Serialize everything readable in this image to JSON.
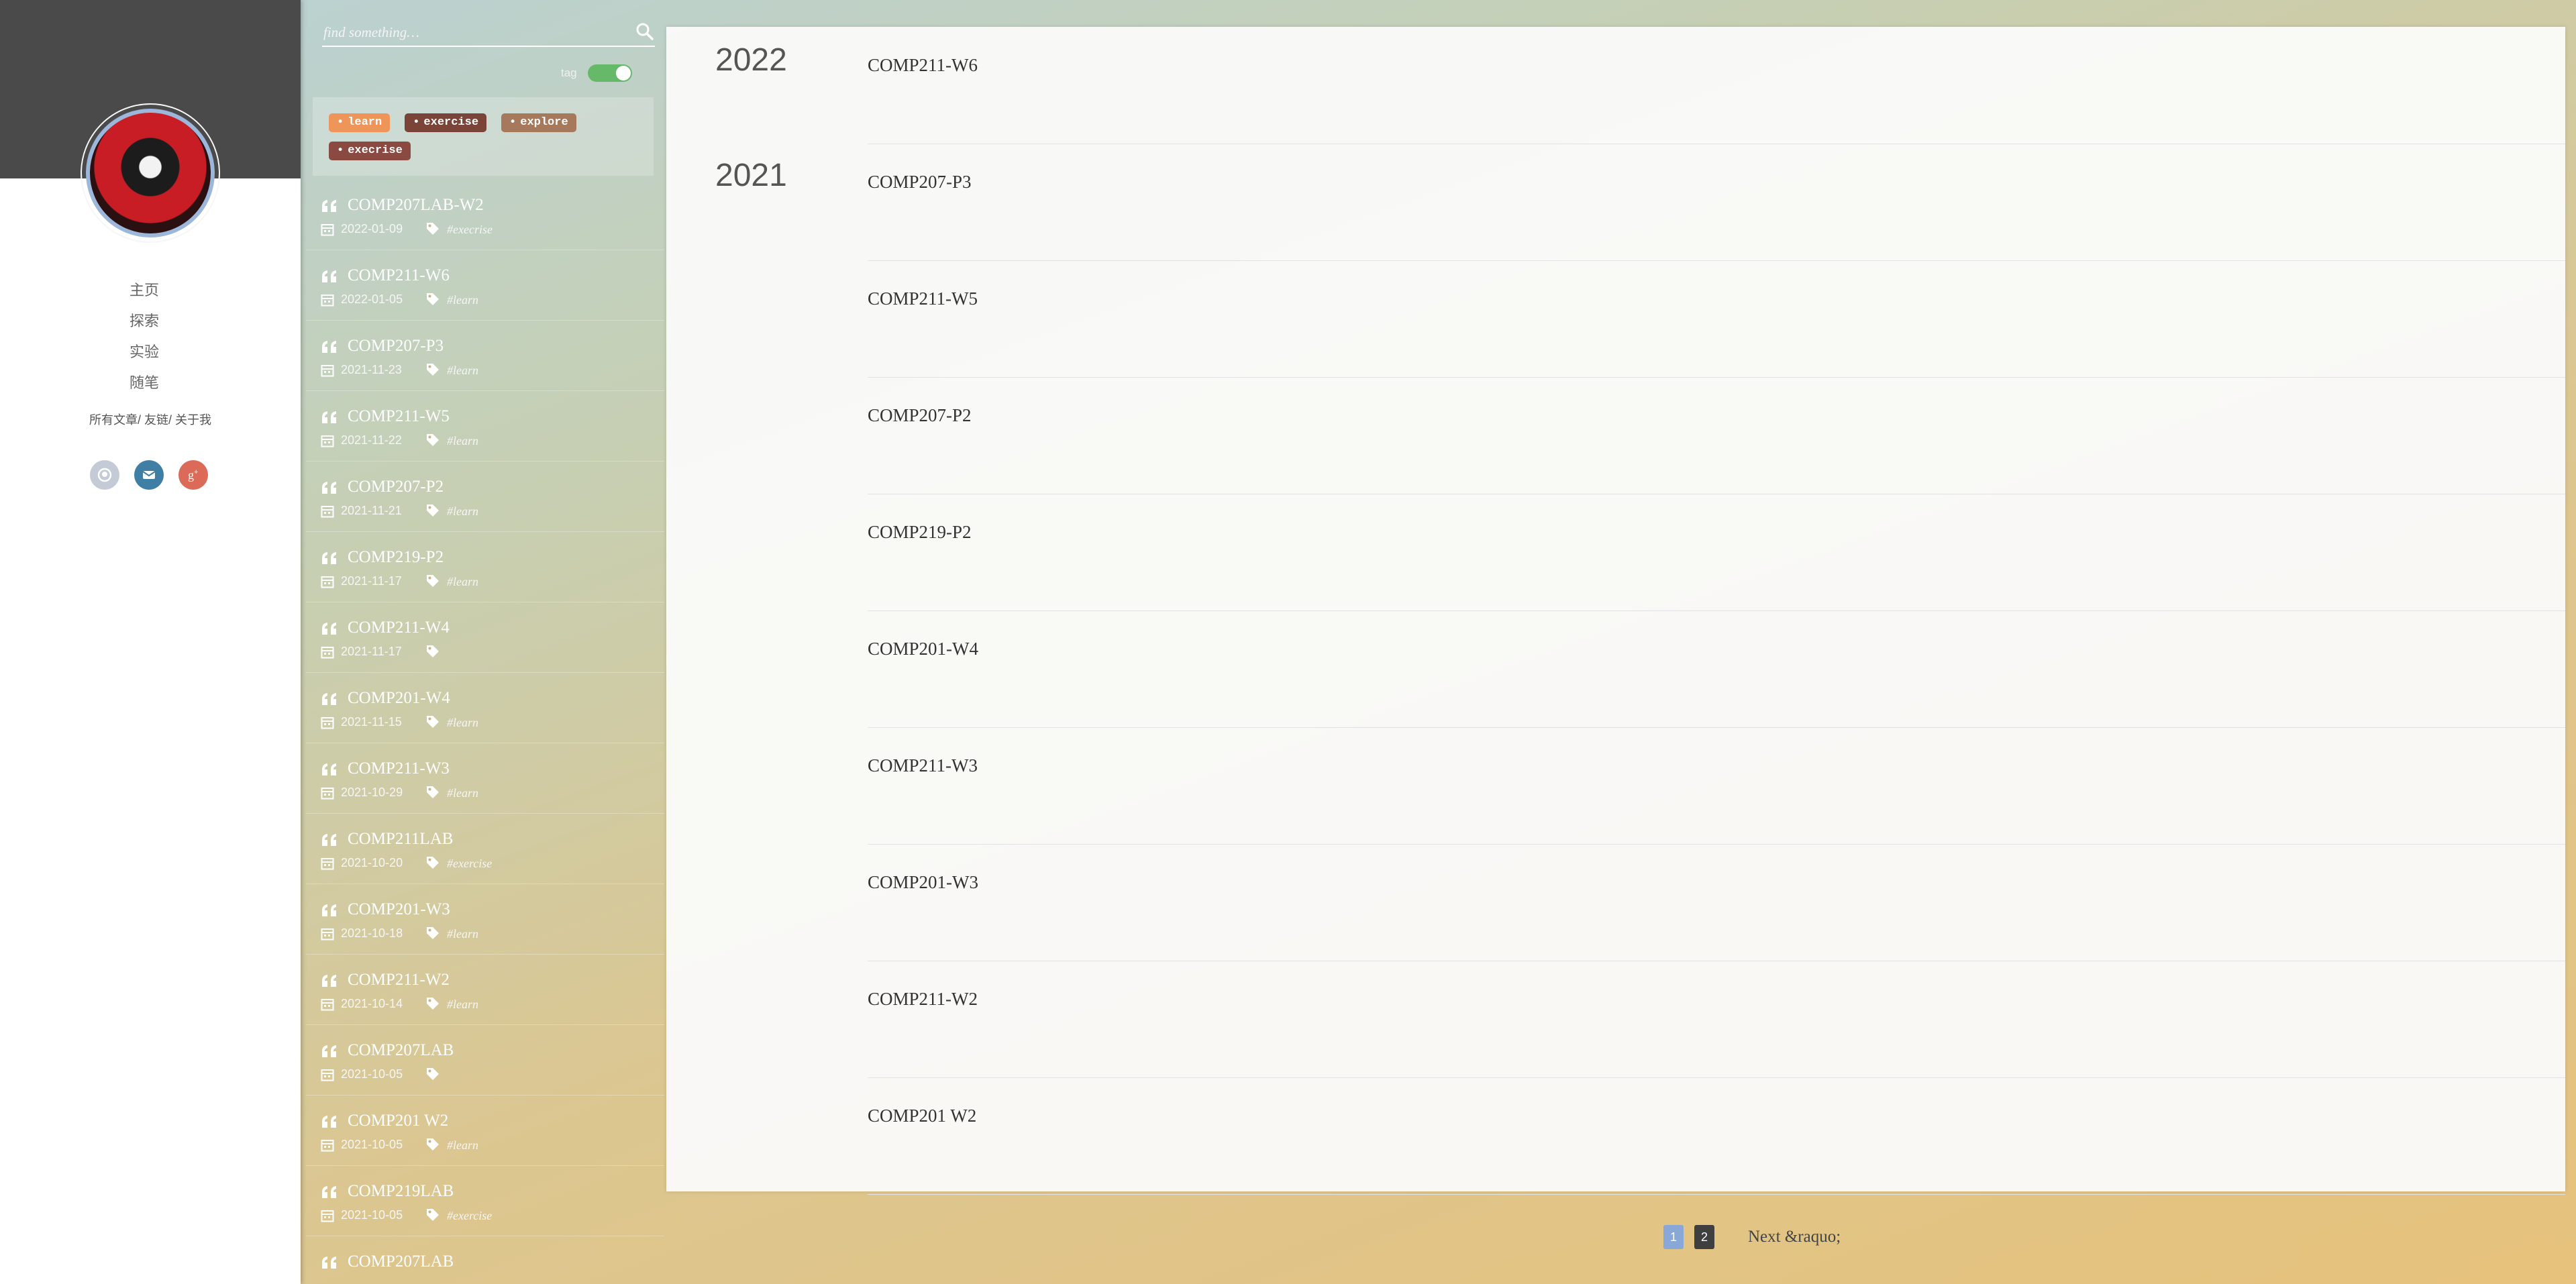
{
  "sidebar": {
    "nav": [
      {
        "label": "主页"
      },
      {
        "label": "探索"
      },
      {
        "label": "实验"
      },
      {
        "label": "随笔"
      }
    ],
    "sublinks": [
      "所有文章",
      "友链",
      "关于我"
    ],
    "social_icons": [
      "github-icon",
      "mail-icon",
      "google-plus-icon"
    ]
  },
  "list": {
    "search_placeholder": "find something…",
    "toggle_label": "tag",
    "tags": [
      {
        "label": "learn",
        "color": "#f0955a"
      },
      {
        "label": "exercise",
        "color": "#7a4438"
      },
      {
        "label": "explore",
        "color": "#a6785c"
      },
      {
        "label": "execrise",
        "color": "#8a4a42"
      }
    ],
    "posts": [
      {
        "title": "COMP207LAB-W2",
        "date": "2022-01-09",
        "tag": "#execrise"
      },
      {
        "title": "COMP211-W6",
        "date": "2022-01-05",
        "tag": "#learn"
      },
      {
        "title": "COMP207-P3",
        "date": "2021-11-23",
        "tag": "#learn"
      },
      {
        "title": "COMP211-W5",
        "date": "2021-11-22",
        "tag": "#learn"
      },
      {
        "title": "COMP207-P2",
        "date": "2021-11-21",
        "tag": "#learn"
      },
      {
        "title": "COMP219-P2",
        "date": "2021-11-17",
        "tag": "#learn"
      },
      {
        "title": "COMP211-W4",
        "date": "2021-11-17",
        "tag": ""
      },
      {
        "title": "COMP201-W4",
        "date": "2021-11-15",
        "tag": "#learn"
      },
      {
        "title": "COMP211-W3",
        "date": "2021-10-29",
        "tag": "#learn"
      },
      {
        "title": "COMP211LAB",
        "date": "2021-10-20",
        "tag": "#exercise"
      },
      {
        "title": "COMP201-W3",
        "date": "2021-10-18",
        "tag": "#learn"
      },
      {
        "title": "COMP211-W2",
        "date": "2021-10-14",
        "tag": "#learn"
      },
      {
        "title": "COMP207LAB",
        "date": "2021-10-05",
        "tag": ""
      },
      {
        "title": "COMP201 W2",
        "date": "2021-10-05",
        "tag": "#learn"
      },
      {
        "title": "COMP219LAB",
        "date": "2021-10-05",
        "tag": "#exercise"
      },
      {
        "title": "COMP207LAB",
        "date": "",
        "tag": ""
      }
    ]
  },
  "archive": {
    "rows": [
      {
        "year": "2022",
        "title": "COMP211-W6"
      },
      {
        "year": "2021",
        "title": "COMP207-P3"
      },
      {
        "year": "",
        "title": "COMP211-W5"
      },
      {
        "year": "",
        "title": "COMP207-P2"
      },
      {
        "year": "",
        "title": "COMP219-P2"
      },
      {
        "year": "",
        "title": "COMP201-W4"
      },
      {
        "year": "",
        "title": "COMP211-W3"
      },
      {
        "year": "",
        "title": "COMP201-W3"
      },
      {
        "year": "",
        "title": "COMP211-W2"
      },
      {
        "year": "",
        "title": "COMP201 W2"
      }
    ]
  },
  "pagination": {
    "pages": [
      "1",
      "2"
    ],
    "current": "1",
    "next_label": "Next &raquo;"
  }
}
